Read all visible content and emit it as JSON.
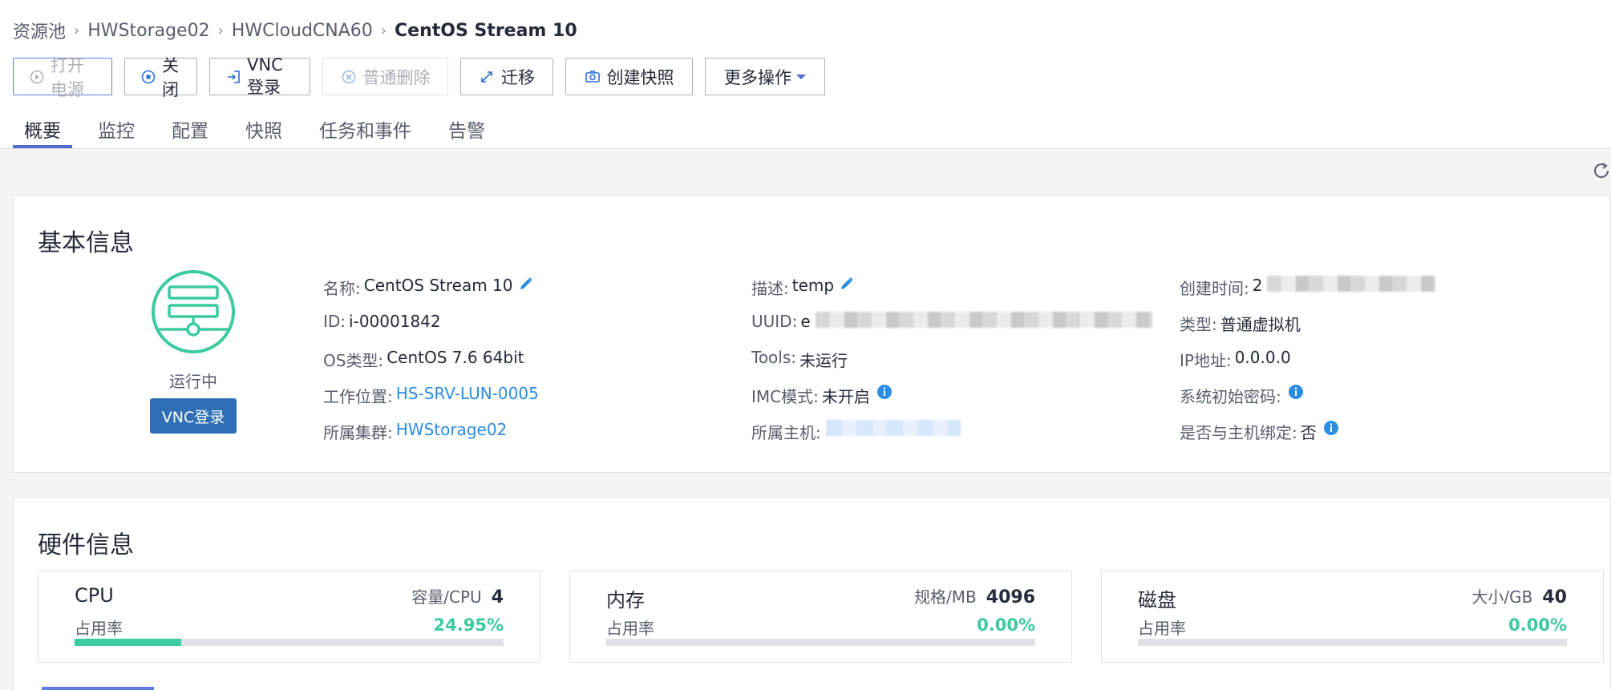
{
  "breadcrumb": [
    "资源池",
    "HWStorage02",
    "HWCloudCNA60",
    "CentOS Stream 10"
  ],
  "toolbar": {
    "power_on": "打开电源",
    "shutdown": "关闭",
    "vnc_login": "VNC登录",
    "delete": "普通删除",
    "migrate": "迁移",
    "snapshot": "创建快照",
    "more": "更多操作"
  },
  "tabs": [
    "概要",
    "监控",
    "配置",
    "快照",
    "任务和事件",
    "告警"
  ],
  "basic": {
    "title": "基本信息",
    "status": "运行中",
    "vnc_button": "VNC登录",
    "col1": {
      "name_label": "名称:",
      "name_value": "CentOS Stream 10",
      "id_label": "ID:",
      "id_value": "i-00001842",
      "os_label": "OS类型:",
      "os_value": "CentOS 7.6 64bit",
      "location_label": "工作位置:",
      "location_value": "HS-SRV-LUN-0005",
      "cluster_label": "所属集群:",
      "cluster_value": "HWStorage02"
    },
    "col2": {
      "desc_label": "描述:",
      "desc_value": "temp",
      "uuid_label": "UUID:",
      "uuid_value": "e",
      "tools_label": "Tools:",
      "tools_value": "未运行",
      "imc_label": "IMC模式:",
      "imc_value": "未开启",
      "host_label": "所属主机:"
    },
    "col3": {
      "created_label": "创建时间:",
      "created_value": "2",
      "type_label": "类型:",
      "type_value": "普通虚拟机",
      "ip_label": "IP地址:",
      "ip_value": "0.0.0.0",
      "init_pwd_label": "系统初始密码:",
      "bind_label": "是否与主机绑定:",
      "bind_value": "否"
    }
  },
  "hardware": {
    "title": "硬件信息",
    "items": [
      {
        "name": "CPU",
        "spec_label": "容量/CPU",
        "spec_value": "4",
        "usage_label": "占用率",
        "usage_value": "24.95%",
        "usage": 24.95
      },
      {
        "name": "内存",
        "spec_label": "规格/MB",
        "spec_value": "4096",
        "usage_label": "占用率",
        "usage_value": "0.00%",
        "usage": 0
      },
      {
        "name": "磁盘",
        "spec_label": "大小/GB",
        "spec_value": "40",
        "usage_label": "占用率",
        "usage_value": "0.00%",
        "usage": 0
      }
    ]
  },
  "colors": {
    "accent": "#526ecc",
    "link": "#2b8de3",
    "success": "#3ccaa0",
    "vnc_button": "#2e6fb7"
  },
  "icons": [
    "power-icon",
    "stop-icon",
    "vnc-icon",
    "delete-icon",
    "migrate-icon",
    "snapshot-icon",
    "refresh-icon",
    "vm-status-icon",
    "edit-icon",
    "info-icon"
  ]
}
